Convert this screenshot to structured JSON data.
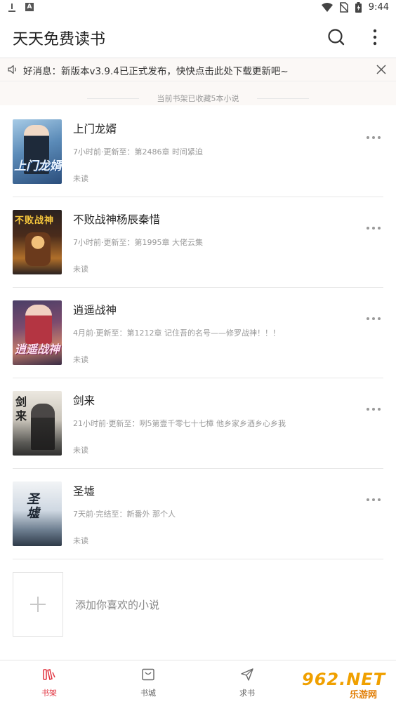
{
  "status_bar": {
    "time": "9:44",
    "notification_letter": "A"
  },
  "app_bar": {
    "title": "天天免费读书"
  },
  "notice": {
    "text": "好消息：新版本v3.9.4已正式发布，快快点击此处下载更新吧~"
  },
  "shelf": {
    "count_text": "当前书架已收藏5本小说",
    "books": [
      {
        "title": "上门龙婿",
        "update": "7小时前·更新至：第2486章 时间紧迫",
        "status": "未读",
        "cover_text": "上门龙婿"
      },
      {
        "title": "不败战神杨辰秦惜",
        "update": "7小时前·更新至：第1995章 大佬云集",
        "status": "未读",
        "cover_text": "不败战神"
      },
      {
        "title": "逍遥战神",
        "update": "4月前·更新至：第1212章 记住吾的名号——修罗战神！！！",
        "status": "未读",
        "cover_text": "逍遥战神"
      },
      {
        "title": "剑来",
        "update": "21小时前·更新至：咧5第壹千零七十七樟 他乡家乡酒乡心乡我",
        "status": "未读",
        "cover_text": "剑来"
      },
      {
        "title": "圣墟",
        "update": "7天前·完结至：新番外 那个人",
        "status": "未读",
        "cover_text": "圣墟"
      }
    ],
    "add_label": "添加你喜欢的小说"
  },
  "bottom_nav": {
    "tabs": [
      {
        "label": "书架",
        "icon": "bookshelf-icon",
        "active": true
      },
      {
        "label": "书城",
        "icon": "bookstore-icon",
        "active": false
      },
      {
        "label": "求书",
        "icon": "send-icon",
        "active": false
      }
    ]
  },
  "watermark": {
    "big": "962.NET",
    "small": "乐游网"
  },
  "colors": {
    "accent": "#e0323e",
    "muted_text": "#999999",
    "notice_bg": "#fbf8f6"
  }
}
